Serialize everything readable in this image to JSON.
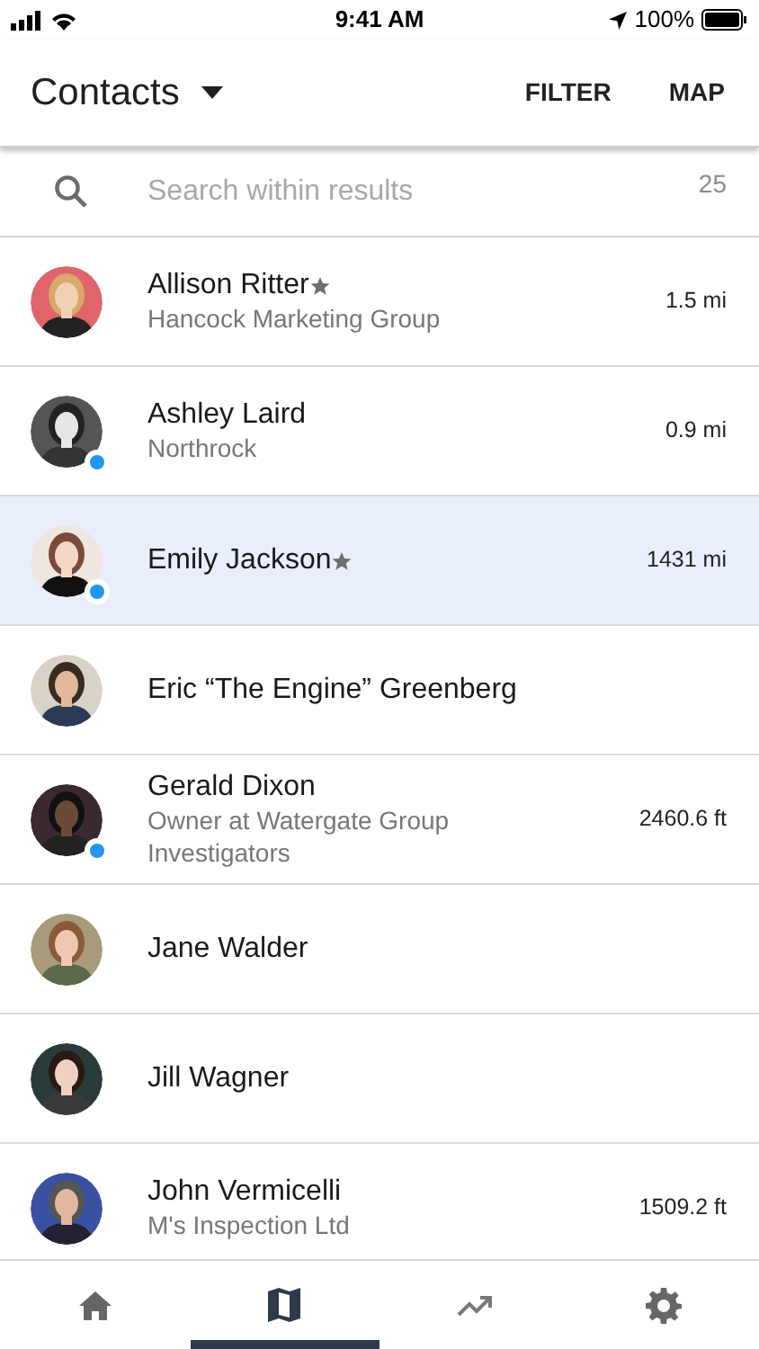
{
  "status_bar": {
    "time": "9:41 AM",
    "battery": "100%"
  },
  "header": {
    "title": "Contacts",
    "actions": [
      "FILTER",
      "MAP"
    ]
  },
  "search": {
    "placeholder": "Search within results",
    "count": "25"
  },
  "rows": [
    {
      "name": "Allison Ritter",
      "starred": true,
      "subtitle": "Hancock Marketing Group",
      "distance": "1.5 mi",
      "online": false,
      "selected": false
    },
    {
      "name": "Ashley Laird",
      "starred": false,
      "subtitle": "Northrock",
      "distance": "0.9 mi",
      "online": true,
      "selected": false
    },
    {
      "name": "Emily Jackson",
      "starred": true,
      "distance": "1431 mi",
      "online": true,
      "selected": true
    },
    {
      "name": "Eric “The Engine” Greenberg",
      "starred": false,
      "online": false,
      "selected": false
    },
    {
      "name": "Gerald Dixon",
      "starred": false,
      "subtitle": "Owner at Watergate Group Investigators",
      "distance": "2460.6 ft",
      "online": true,
      "selected": false
    },
    {
      "name": "Jane Walder",
      "starred": false,
      "online": false,
      "selected": false
    },
    {
      "name": "Jill Wagner",
      "starred": false,
      "online": false,
      "selected": false
    },
    {
      "name": "John Vermicelli",
      "starred": false,
      "subtitle": "M's Inspection Ltd",
      "distance": "1509.2 ft",
      "online": false,
      "selected": false
    }
  ],
  "tabs": [
    {
      "kind": "home",
      "selected": false
    },
    {
      "kind": "map",
      "selected": true
    },
    {
      "kind": "trend",
      "selected": false
    },
    {
      "kind": "settings",
      "selected": false
    }
  ]
}
